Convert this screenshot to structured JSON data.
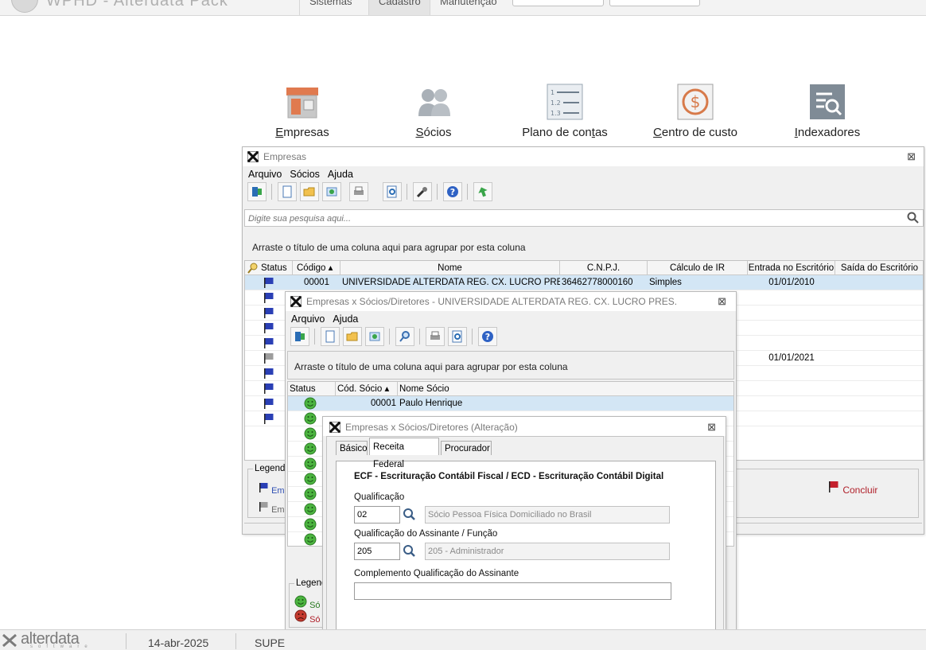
{
  "topbar": {
    "app_title": "WPHD - Alterdata Pack",
    "menu": [
      "Sistemas",
      "Cadastro",
      "Manutenção"
    ],
    "active_menu": "Cadastro"
  },
  "modules": [
    {
      "label_u": "E",
      "label_rest": "mpresas"
    },
    {
      "label_u": "S",
      "label_rest": "ócios"
    },
    {
      "label_pre": "Plano de con",
      "label_u": "t",
      "label_rest": "as"
    },
    {
      "label_u": "C",
      "label_rest": "entro de custo"
    },
    {
      "label_u": "I",
      "label_rest": "ndexadores"
    }
  ],
  "empresas_window": {
    "title": "Empresas",
    "menu": [
      "Arquivo",
      "Sócios",
      "Ajuda"
    ],
    "search_placeholder": "Digite sua pesquisa aqui...",
    "group_hint": "Arraste o título de uma coluna aqui para agrupar por esta coluna",
    "columns": [
      "Status",
      "Código",
      "Nome",
      "C.N.P.J.",
      "Cálculo de IR",
      "Entrada no Escritório",
      "Saída do Escritório"
    ],
    "rows": [
      {
        "codigo": "00001",
        "nome": "UNIVERSIDADE ALTERDATA REG. CX. LUCRO PRES",
        "cnpj": "36462778000160",
        "calculo": "Simples",
        "entrada": "01/01/2010",
        "saida": "",
        "flag": "blue"
      },
      {
        "codigo": "",
        "nome": "",
        "cnpj": "",
        "calculo": "",
        "entrada": "",
        "saida": "",
        "flag": "blue"
      },
      {
        "codigo": "",
        "nome": "",
        "cnpj": "",
        "calculo": "",
        "entrada": "",
        "saida": "",
        "flag": "blue"
      },
      {
        "codigo": "",
        "nome": "",
        "cnpj": "",
        "calculo": "",
        "entrada": "",
        "saida": "",
        "flag": "blue"
      },
      {
        "codigo": "",
        "nome": "",
        "cnpj": "",
        "calculo": "",
        "entrada": "",
        "saida": "",
        "flag": "blue"
      },
      {
        "codigo": "",
        "nome": "",
        "cnpj": "",
        "calculo": "",
        "entrada": "01/01/2021",
        "saida": "",
        "flag": "gray"
      },
      {
        "codigo": "",
        "nome": "",
        "cnpj": "",
        "calculo": "",
        "entrada": "",
        "saida": "",
        "flag": "blue"
      },
      {
        "codigo": "",
        "nome": "",
        "cnpj": "",
        "calculo": "",
        "entrada": "",
        "saida": "",
        "flag": "blue"
      },
      {
        "codigo": "",
        "nome": "",
        "cnpj": "",
        "calculo": "",
        "entrada": "",
        "saida": "",
        "flag": "blue"
      },
      {
        "codigo": "",
        "nome": "",
        "cnpj": "",
        "calculo": "",
        "entrada": "",
        "saida": "",
        "flag": "blue"
      }
    ],
    "legend_title": "Legenda",
    "legend_items": [
      "Em",
      "Em"
    ],
    "concluir_label": "Concluir"
  },
  "socios_window": {
    "title": "Empresas x Sócios/Diretores - UNIVERSIDADE ALTERDATA REG. CX. LUCRO PRES.",
    "menu": [
      "Arquivo",
      "Ajuda"
    ],
    "group_hint": "Arraste o título de uma coluna aqui para agrupar por esta coluna",
    "columns": [
      "Status",
      "Cód. Sócio",
      "Nome Sócio"
    ],
    "rows": [
      {
        "cod": "00001",
        "nome": "Paulo Henrique"
      }
    ],
    "status_icon_count": 10,
    "legend_title": "Legenda",
    "legend_items": [
      "Só",
      "Só"
    ]
  },
  "alteracao_dialog": {
    "title": "Empresas x Sócios/Diretores (Alteração)",
    "tabs": [
      "Básico",
      "Receita Federal",
      "Procurador"
    ],
    "active_tab": "Receita Federal",
    "section_title": "ECF - Escrituração Contábil Fiscal / ECD - Escrituração Contábil Digital",
    "qualificacao_label": "Qualificação",
    "qualificacao_code": "02",
    "qualificacao_desc": "Sócio Pessoa Física Domiciliado no Brasil",
    "assinante_label": "Qualificação do Assinante / Função",
    "assinante_code": "205",
    "assinante_desc": "205 - Administrador",
    "complemento_label": "Complemento Qualificação do Assinante",
    "complemento_value": ""
  },
  "statusbar": {
    "brand": "alterdata",
    "brand_sub": "software",
    "date": "14-abr-2025",
    "user": "SUPE"
  }
}
